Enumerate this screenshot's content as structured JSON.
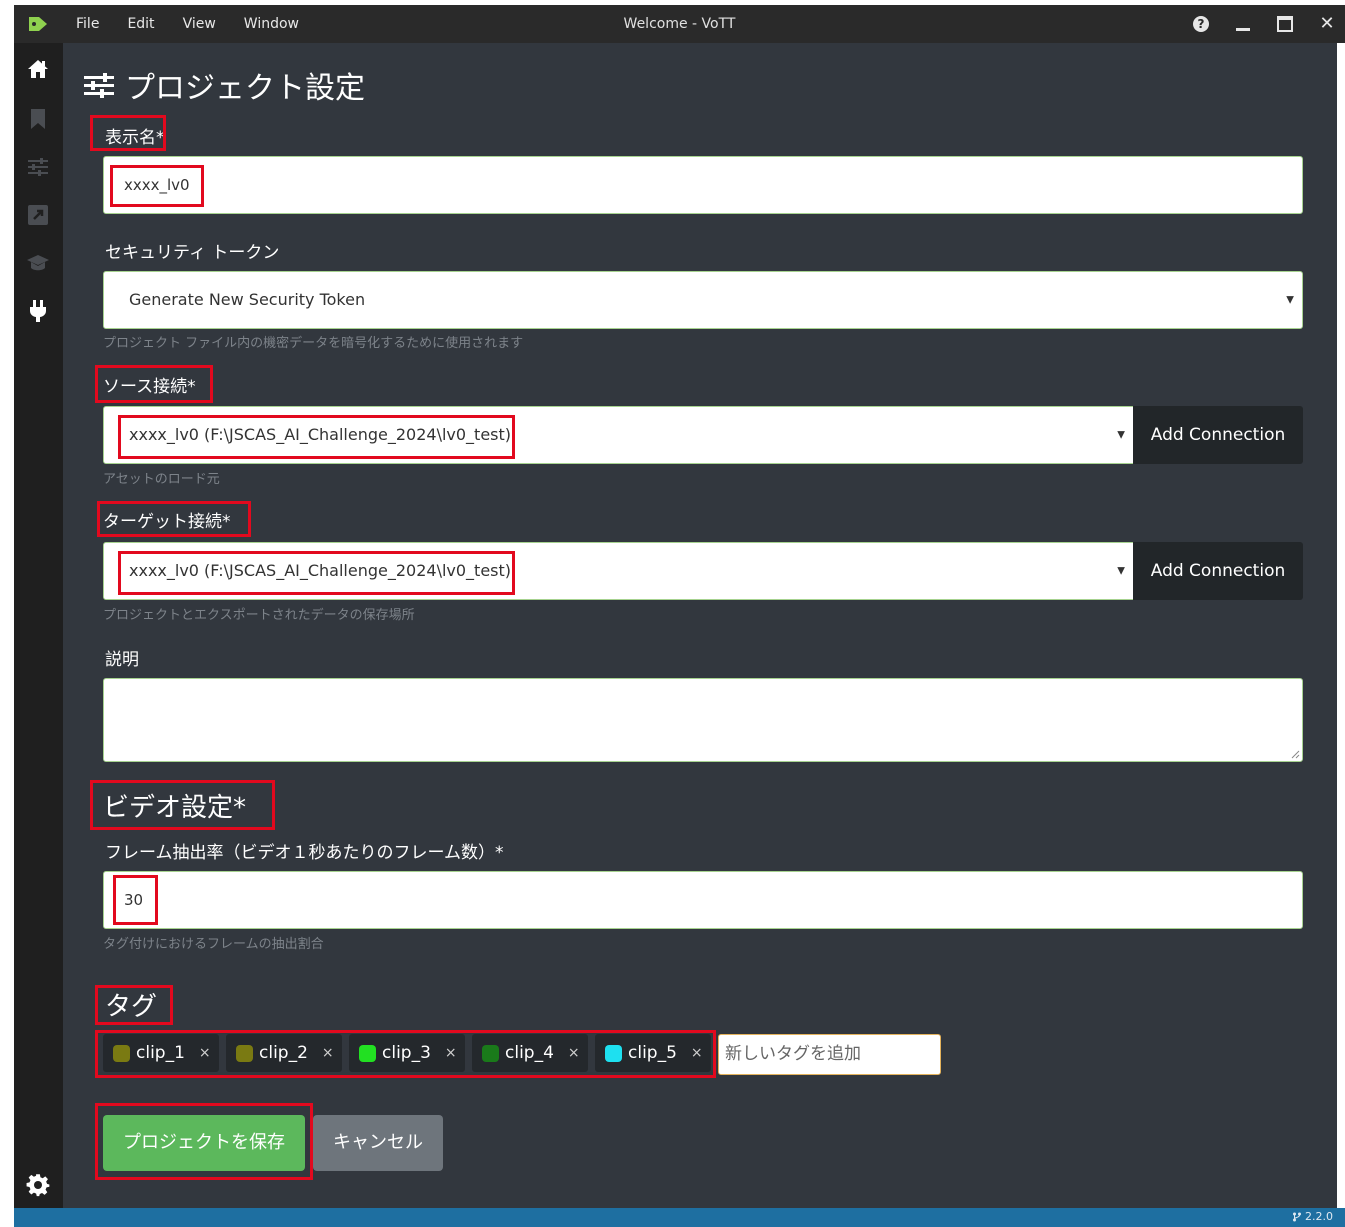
{
  "window": {
    "title": "Welcome - VoTT",
    "menu": [
      "File",
      "Edit",
      "View",
      "Window"
    ],
    "controls": [
      "help-icon",
      "minimize-icon",
      "maximize-icon",
      "close-icon"
    ]
  },
  "sidebar": {
    "items": [
      {
        "name": "home-icon",
        "active": true
      },
      {
        "name": "bookmark-icon",
        "active": false
      },
      {
        "name": "sliders-icon",
        "active": false
      },
      {
        "name": "export-icon",
        "active": false
      },
      {
        "name": "graduation-cap-icon",
        "active": false
      },
      {
        "name": "plug-icon",
        "active": true
      }
    ],
    "bottom": "gear-icon"
  },
  "page": {
    "title": "プロジェクト設定",
    "display_name": {
      "label": "表示名*",
      "value": "xxxx_lv0"
    },
    "security_token": {
      "label": "セキュリティ トークン",
      "selected": "Generate New Security Token",
      "help": "プロジェクト ファイル内の機密データを暗号化するために使用されます"
    },
    "source_connection": {
      "label": "ソース接続*",
      "selected": "xxxx_lv0 (F:\\JSCAS_AI_Challenge_2024\\lv0_test)",
      "button": "Add Connection",
      "help": "アセットのロード元"
    },
    "target_connection": {
      "label": "ターゲット接続*",
      "selected": "xxxx_lv0 (F:\\JSCAS_AI_Challenge_2024\\lv0_test)",
      "button": "Add Connection",
      "help": "プロジェクトとエクスポートされたデータの保存場所"
    },
    "description": {
      "label": "説明",
      "value": ""
    },
    "video": {
      "section_title": "ビデオ設定*",
      "frame_rate_label": "フレーム抽出率（ビデオ１秒あたりのフレーム数）*",
      "frame_rate_value": "30",
      "help": "タグ付けにおけるフレームの抽出割合"
    },
    "tags": {
      "section_title": "タグ",
      "items": [
        {
          "label": "clip_1",
          "color": "#7a7a12"
        },
        {
          "label": "clip_2",
          "color": "#7a7a12"
        },
        {
          "label": "clip_3",
          "color": "#22e022"
        },
        {
          "label": "clip_4",
          "color": "#1a7a1a"
        },
        {
          "label": "clip_5",
          "color": "#1ee0f0"
        }
      ],
      "remove_glyph": "×",
      "input_placeholder": "新しいタグを追加"
    },
    "buttons": {
      "save": "プロジェクトを保存",
      "cancel": "キャンセル"
    }
  },
  "status": {
    "version": "2.2.0"
  },
  "colors": {
    "accent_green": "#5cb85c",
    "highlight_red": "#e2091e",
    "status_blue": "#1e6fa1"
  }
}
